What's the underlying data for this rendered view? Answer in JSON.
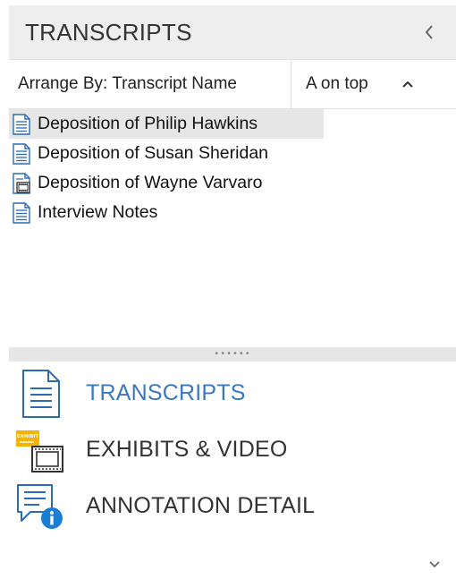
{
  "panel": {
    "title": "TRANSCRIPTS",
    "collapse_glyph": "‹"
  },
  "sort_bar": {
    "field_label": "Arrange By: Transcript Name",
    "order_label": "A on top",
    "direction_glyph": "^"
  },
  "transcripts": [
    {
      "name": "Deposition of Philip Hawkins",
      "icon": "document-icon",
      "selected": true
    },
    {
      "name": "Deposition of Susan Sheridan",
      "icon": "document-icon",
      "selected": false
    },
    {
      "name": "Deposition of Wayne Varvaro",
      "icon": "video-document-icon",
      "selected": false
    },
    {
      "name": "Interview Notes",
      "icon": "document-icon",
      "selected": false
    }
  ],
  "splitter": {
    "dots": "••••••"
  },
  "nav": [
    {
      "label": "TRANSCRIPTS",
      "icon": "transcripts-icon",
      "active": true
    },
    {
      "label": "EXHIBITS & VIDEO",
      "icon": "exhibits-video-icon",
      "active": false
    },
    {
      "label": "ANNOTATION DETAIL",
      "icon": "annotation-detail-icon",
      "active": false
    }
  ],
  "colors": {
    "accent": "#3a78c3",
    "header_bg": "#eeeeee",
    "selection_bg": "#e6e6e6",
    "exhibit_badge": "#f5b400",
    "info_blue": "#1a7fd4"
  }
}
